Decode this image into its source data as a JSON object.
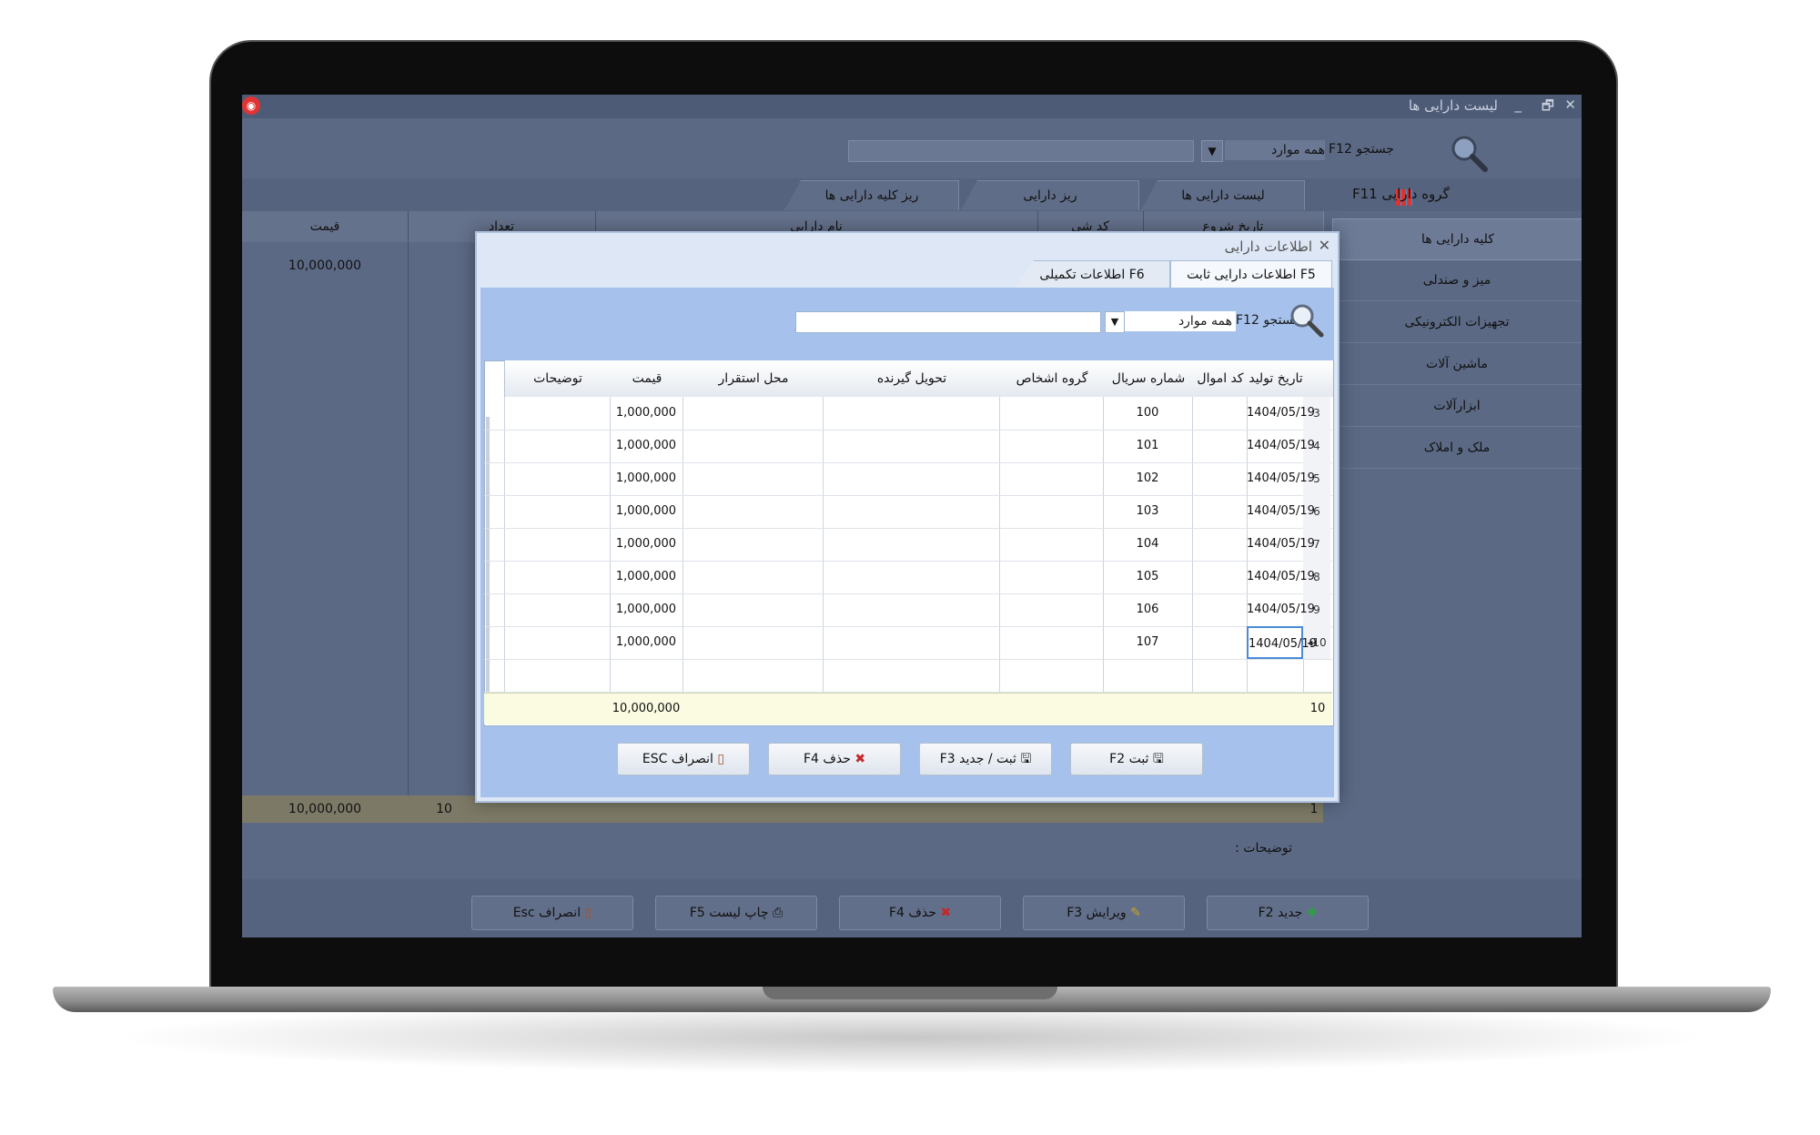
{
  "app": {
    "title": "لیست دارایی ها",
    "window_controls": [
      "_",
      "🗗",
      "✕"
    ],
    "logo_glyph": "◉"
  },
  "search": {
    "label": "جستجو F12",
    "filter_value": "همه موارد",
    "query": ""
  },
  "tabs": [
    {
      "label": "لیست دارایی ها"
    },
    {
      "label": "ریز دارایی"
    },
    {
      "label": "ریز کلیه دارایی ها"
    }
  ],
  "side": {
    "group_label": "گروه دارایی F11",
    "items": [
      {
        "label": "کلیه دارایی ها"
      },
      {
        "label": "میز و صندلی"
      },
      {
        "label": "تجهیزات الکترونیکی"
      },
      {
        "label": "ماشین آلات"
      },
      {
        "label": "ابزارآلات"
      },
      {
        "label": "ملک و املاک"
      }
    ]
  },
  "main_grid": {
    "headers": [
      "قیمت",
      "تعداد",
      "نام دارایی",
      "کد شی",
      "تاریخ شروع"
    ],
    "first_value": "10,000,000",
    "totals": {
      "price": "10,000,000",
      "count": "10",
      "rows": "1"
    }
  },
  "notes_label": "توضیحات :",
  "bottom_buttons": [
    {
      "label": "جدید F2",
      "icon": "plus-icon"
    },
    {
      "label": "ویرایش F3",
      "icon": "pencil-icon"
    },
    {
      "label": "حذف F4",
      "icon": "cross-icon"
    },
    {
      "label": "چاپ لیست F5",
      "icon": "printer-icon"
    },
    {
      "label": "انصراف Esc",
      "icon": "door-icon"
    }
  ],
  "dialog": {
    "title": "اطلاعات دارایی",
    "close": "✕",
    "tabs": [
      {
        "label": "F5 اطلاعات دارایی ثابت"
      },
      {
        "label": "F6 اطلاعات تکمیلی"
      }
    ],
    "search": {
      "label": "جستجو F12",
      "filter_value": "همه موارد",
      "query": ""
    },
    "columns": {
      "date": "تاریخ تولید",
      "code": "کد اموال",
      "serial": "شماره سریال",
      "group": "گروه اشخاص",
      "receiver": "تحویل گیرنده",
      "location": "محل استقرار",
      "price": "قیمت",
      "notes": "توضیحات"
    },
    "rows": [
      {
        "n": "3",
        "date": "1404/05/19",
        "serial": "100",
        "price": "1,000,000"
      },
      {
        "n": "4",
        "date": "1404/05/19",
        "serial": "101",
        "price": "1,000,000"
      },
      {
        "n": "5",
        "date": "1404/05/19",
        "serial": "102",
        "price": "1,000,000"
      },
      {
        "n": "6",
        "date": "1404/05/19",
        "serial": "103",
        "price": "1,000,000"
      },
      {
        "n": "7",
        "date": "1404/05/19",
        "serial": "104",
        "price": "1,000,000"
      },
      {
        "n": "8",
        "date": "1404/05/19",
        "serial": "105",
        "price": "1,000,000"
      },
      {
        "n": "9",
        "date": "1404/05/19",
        "serial": "106",
        "price": "1,000,000"
      },
      {
        "n": "10",
        "date": "1404/05/19",
        "serial": "107",
        "price": "1,000,000",
        "current": "◂"
      }
    ],
    "total": {
      "count": "10",
      "price": "10,000,000"
    },
    "buttons": [
      {
        "label": "ثبت F2",
        "icon": "save-icon"
      },
      {
        "label": "ثبت / جدید F3",
        "icon": "save-new-icon"
      },
      {
        "label": "حذف F4",
        "icon": "cross-icon"
      },
      {
        "label": "انصراف ESC",
        "icon": "door-icon"
      }
    ]
  }
}
